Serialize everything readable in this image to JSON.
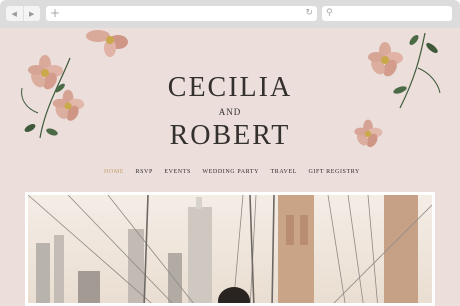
{
  "browser": {
    "back_icon": "back-arrow-icon",
    "forward_icon": "forward-arrow-icon",
    "new_tab_icon": "plus-icon",
    "reload_icon": "reload-icon",
    "search_icon": "search-icon"
  },
  "header": {
    "name1": "CECILIA",
    "conjunction": "AND",
    "name2": "ROBERT"
  },
  "nav": {
    "items": [
      {
        "label": "Home",
        "active": true
      },
      {
        "label": "RSVP",
        "active": false
      },
      {
        "label": "Events",
        "active": false
      },
      {
        "label": "Wedding Party",
        "active": false
      },
      {
        "label": "Travel",
        "active": false
      },
      {
        "label": "Gift Registry",
        "active": false
      }
    ]
  },
  "colors": {
    "background": "#ebdedb",
    "accent_active": "#c9a171",
    "text": "#33302d",
    "flower_petal": "#d9a99a",
    "leaf": "#3f5a3a"
  },
  "hero": {
    "image_subject": "couple on a suspension bridge with a city skyline"
  }
}
